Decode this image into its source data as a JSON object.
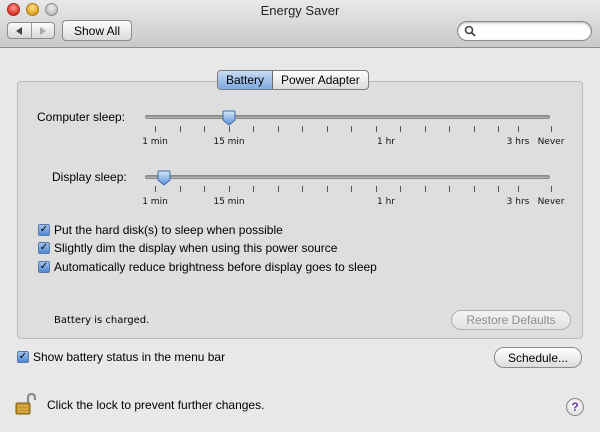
{
  "window": {
    "title": "Energy Saver"
  },
  "toolbar": {
    "show_all_label": "Show All",
    "search_placeholder": ""
  },
  "tabs": [
    {
      "label": "Battery",
      "selected": true
    },
    {
      "label": "Power Adapter",
      "selected": false
    }
  ],
  "sliders": {
    "computer_sleep": {
      "label": "Computer sleep:",
      "tick_labels": [
        "1 min",
        "15 min",
        "1 hr",
        "3 hrs",
        "Never"
      ],
      "value_label": "15 min"
    },
    "display_sleep": {
      "label": "Display sleep:",
      "tick_labels": [
        "1 min",
        "15 min",
        "1 hr",
        "3 hrs",
        "Never"
      ],
      "value_label": "2 min"
    }
  },
  "options": [
    {
      "label": "Put the hard disk(s) to sleep when possible",
      "checked": true
    },
    {
      "label": "Slightly dim the display when using this power source",
      "checked": true
    },
    {
      "label": "Automatically reduce brightness before display goes to sleep",
      "checked": true
    }
  ],
  "status_text": "Battery is charged.",
  "restore_defaults_label": "Restore Defaults",
  "menu_bar_option": {
    "label": "Show battery status in the menu bar",
    "checked": true
  },
  "schedule_label": "Schedule...",
  "lock_text": "Click the lock to prevent further changes.",
  "help_label": "?",
  "colors": {
    "accent": "#7ea9e0",
    "help_glyph": "#6a3a9e"
  }
}
